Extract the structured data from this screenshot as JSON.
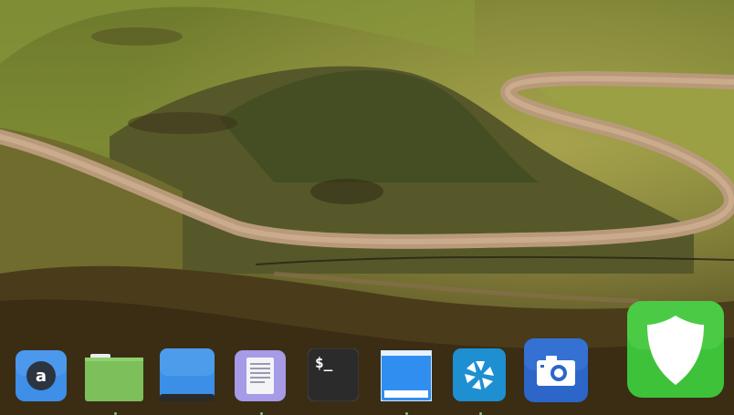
{
  "desktop": {
    "wallpaper": "hills-winding-road-landscape"
  },
  "dock": {
    "items": [
      {
        "icon": "app-store-icon",
        "color": "#3f8ee8"
      },
      {
        "icon": "folder-icon",
        "color": "#7cbf5b"
      },
      {
        "icon": "desktop-icon",
        "color": "#3b8fe6"
      },
      {
        "icon": "text-editor-icon",
        "color": "#a59be6"
      },
      {
        "icon": "terminal-icon",
        "color": "#2b2b2b",
        "text": "$_"
      },
      {
        "icon": "window-manager-icon",
        "color": "#2f8ef0"
      },
      {
        "icon": "shutter-camera-icon",
        "color": "#1e8fd1"
      },
      {
        "icon": "screenshot-camera-icon",
        "color": "#2c66c9"
      },
      {
        "icon": "security-shield-icon",
        "color": "#3ec23a"
      }
    ]
  }
}
